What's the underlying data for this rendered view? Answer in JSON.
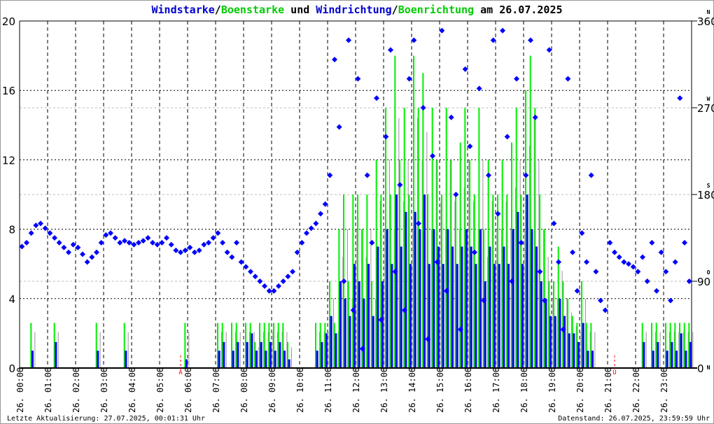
{
  "chart_data": {
    "type": "bar",
    "title_parts": [
      {
        "text": "Windstarke",
        "color": "#0000cc"
      },
      {
        "text": "/",
        "color": "#000000"
      },
      {
        "text": "Boenstarke",
        "color": "#00cc00"
      },
      {
        "text": " und ",
        "color": "#000000"
      },
      {
        "text": "Windrichtung",
        "color": "#0000cc"
      },
      {
        "text": "/",
        "color": "#000000"
      },
      {
        "text": "Boenrichtung",
        "color": "#00cc00"
      },
      {
        "text": " am 26.07.2025",
        "color": "#000000"
      }
    ],
    "x_range_hours": [
      0,
      24
    ],
    "x_tick_labels": [
      "26. 00:00",
      "26. 01:00",
      "26. 02:00",
      "26. 03:00",
      "26. 04:00",
      "26. 05:00",
      "26. 06:00",
      "26. 07:00",
      "26. 08:00",
      "26. 09:00",
      "26. 10:00",
      "26. 11:00",
      "26. 12:00",
      "26. 13:00",
      "26. 14:00",
      "26. 15:00",
      "26. 16:00",
      "26. 17:00",
      "26. 18:00",
      "26. 19:00",
      "26. 20:00",
      "26. 21:00",
      "26. 22:00",
      "26. 23:00"
    ],
    "y_left": {
      "range": [
        0,
        20
      ],
      "ticks": [
        0,
        4,
        8,
        12,
        16,
        20
      ]
    },
    "y_right": {
      "range": [
        0,
        360
      ],
      "ticks": [
        0,
        90,
        180,
        270,
        360
      ],
      "compass": {
        "0": "N",
        "90": "O",
        "180": "S",
        "270": "W",
        "360": "N"
      }
    },
    "grid": true,
    "colors": {
      "wind": "#0000ff",
      "gust": "#00ee00",
      "grid": "#000000",
      "minor_grid": "#bbbbbb",
      "marker": "#ff0000"
    },
    "sample_interval_minutes": 10,
    "series": [
      {
        "name": "Boenstarke",
        "kind": "bar",
        "axis": "left",
        "values": [
          0,
          0,
          2.6,
          0,
          0,
          0,
          0,
          2.6,
          0,
          0,
          0,
          0,
          0,
          0,
          0,
          0,
          2.6,
          0,
          0,
          0,
          0,
          0,
          2.6,
          0,
          0,
          0,
          0,
          0,
          0,
          0,
          0,
          0,
          0,
          0,
          0,
          2.6,
          0,
          0,
          0,
          0,
          0,
          0,
          2.6,
          2.6,
          0,
          2.6,
          2.6,
          0,
          2.6,
          2.6,
          1.5,
          2.6,
          2.6,
          2.6,
          2.6,
          2.6,
          2.6,
          1.5,
          0,
          0,
          0,
          0,
          0,
          2.6,
          2.6,
          2.6,
          5,
          2.6,
          8,
          10,
          5,
          10,
          10,
          8,
          10,
          5,
          12,
          10,
          15,
          10,
          18,
          12,
          15,
          10,
          18,
          15,
          17,
          10,
          15,
          12,
          10,
          15,
          12,
          10,
          13,
          15,
          12,
          10,
          15,
          8,
          12,
          10,
          10,
          12,
          10,
          13,
          15,
          10,
          16,
          18,
          15,
          10,
          8,
          5,
          5,
          7,
          5,
          4,
          3,
          2.6,
          5,
          2.6,
          2.6,
          0,
          0,
          0,
          0,
          0,
          0,
          0,
          0,
          0,
          0,
          2.6,
          0,
          2.6,
          2.6,
          0,
          2.6,
          2.6,
          2.6,
          2.6,
          2.6,
          2.6
        ]
      },
      {
        "name": "Windstarke",
        "kind": "bar",
        "axis": "left",
        "values": [
          0,
          0,
          1,
          0,
          0,
          0,
          0,
          1.5,
          0,
          0,
          0,
          0,
          0,
          0,
          0,
          0,
          1,
          0,
          0,
          0,
          0,
          0,
          1,
          0,
          0,
          0,
          0,
          0,
          0,
          0,
          0,
          0,
          0,
          0,
          0,
          0.5,
          0,
          0,
          0,
          0,
          0,
          0,
          1,
          1.5,
          0,
          1,
          1.5,
          0,
          1.5,
          2,
          1,
          1.5,
          1,
          1.5,
          1,
          1.5,
          1,
          0.5,
          0,
          0,
          0,
          0,
          0,
          1,
          1.5,
          2,
          3,
          2,
          5,
          4,
          3,
          6,
          5,
          4,
          6,
          3,
          7,
          5,
          8,
          6,
          10,
          7,
          9,
          6,
          9,
          8,
          10,
          6,
          8,
          7,
          6,
          8,
          7,
          6,
          7,
          8,
          7,
          6,
          8,
          5,
          7,
          6,
          6,
          7,
          6,
          8,
          9,
          6,
          10,
          8,
          7,
          5,
          4,
          3,
          3,
          4,
          3,
          2,
          2,
          1.5,
          2.6,
          1,
          1,
          0,
          0,
          0,
          0,
          0,
          0,
          0,
          0,
          0,
          0,
          1.5,
          0,
          1,
          1.5,
          0,
          1,
          1.5,
          1,
          2,
          1,
          1.5
        ]
      },
      {
        "name": "Windrichtung",
        "kind": "scatter",
        "axis": "right",
        "values": [
          126,
          130,
          140,
          148,
          150,
          145,
          140,
          135,
          130,
          125,
          120,
          128,
          125,
          118,
          110,
          115,
          120,
          130,
          138,
          140,
          135,
          130,
          132,
          130,
          128,
          130,
          132,
          135,
          130,
          128,
          130,
          135,
          128,
          122,
          120,
          122,
          125,
          120,
          122,
          128,
          130,
          135,
          140,
          130,
          120,
          115,
          130,
          110,
          105,
          100,
          95,
          90,
          85,
          80,
          80,
          85,
          90,
          95,
          100,
          120,
          130,
          140,
          145,
          150,
          160,
          170,
          200,
          320,
          250,
          90,
          340,
          60,
          300,
          20,
          200,
          130,
          280,
          50,
          240,
          330,
          100,
          190,
          60,
          300,
          340,
          150,
          270,
          30,
          220,
          110,
          350,
          80,
          260,
          180,
          40,
          310,
          230,
          120,
          290,
          70,
          200,
          340,
          160,
          350,
          240,
          90,
          300,
          130,
          200,
          340,
          260,
          100,
          70,
          330,
          150,
          110,
          40,
          300,
          120,
          80,
          140,
          110,
          200,
          100,
          70,
          60,
          130,
          120,
          115,
          110,
          108,
          105,
          100,
          115,
          90,
          130,
          80,
          120,
          100,
          70,
          110,
          280,
          130,
          90
        ]
      }
    ],
    "annotations": [
      {
        "label": "A",
        "time": "05:45"
      },
      {
        "label": "U",
        "time": "21:15"
      }
    ]
  },
  "footer": {
    "last_update": "Letzte Aktualisierung: 27.07.2025, 00:01:31 Uhr",
    "data_state": "Datenstand: 26.07.2025, 23:59:59 Uhr"
  }
}
